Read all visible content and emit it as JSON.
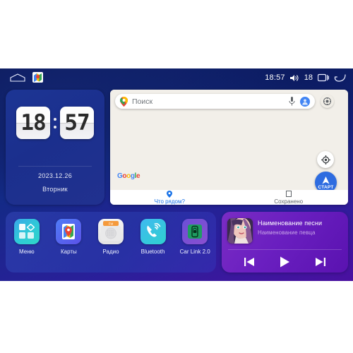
{
  "statusbar": {
    "home_icon": "home-icon",
    "maps_icon": "maps-app-icon",
    "time": "18:57",
    "volume_icon": "volume-icon",
    "volume_level": "18",
    "recents_icon": "recent-apps-icon",
    "back_icon": "back-icon"
  },
  "clock": {
    "hours": "18",
    "minutes": "57",
    "date": "2023.12.26",
    "weekday": "Вторник"
  },
  "map": {
    "search_placeholder": "Поиск",
    "pin_icon": "map-pin-icon",
    "mic_icon": "microphone-icon",
    "avatar_icon": "account-avatar-icon",
    "layers_icon": "map-layers-icon",
    "locate_icon": "my-location-icon",
    "start_label": "СТАРТ",
    "google_logo": "Google",
    "tabs": [
      {
        "label": "Что рядом?",
        "icon": "pin-icon",
        "active": true
      },
      {
        "label": "Сохранено",
        "icon": "bookmark-icon",
        "active": false
      }
    ]
  },
  "dock": {
    "apps": [
      {
        "label": "Меню",
        "icon": "menu-grid-icon"
      },
      {
        "label": "Карты",
        "icon": "maps-icon"
      },
      {
        "label": "Радио",
        "icon": "radio-fm-icon"
      },
      {
        "label": "Bluetooth",
        "icon": "bluetooth-phone-icon"
      },
      {
        "label": "Car Link 2.0",
        "icon": "car-link-icon"
      }
    ]
  },
  "music": {
    "album_art": "album-art-portrait",
    "title": "Наименование песни",
    "artist": "Наименование певца",
    "prev_icon": "previous-track-icon",
    "play_icon": "play-icon",
    "next_icon": "next-track-icon"
  },
  "colors": {
    "accent_blue": "#1a73e8",
    "start_button": "#2e6ce0",
    "music_purple": "#6a1fc0",
    "map_bg": "#f2efe9"
  }
}
